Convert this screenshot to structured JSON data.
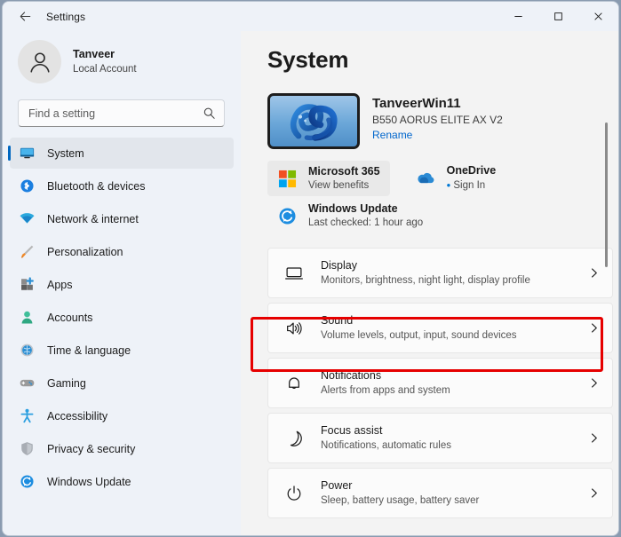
{
  "titlebar": {
    "back_icon": "back-arrow-icon",
    "title": "Settings",
    "minimize_label": "─",
    "maximize_label": "□",
    "close_label": "✕"
  },
  "sidebar": {
    "account": {
      "name": "Tanveer",
      "subtitle": "Local Account",
      "avatar_icon": "person-avatar-icon"
    },
    "search": {
      "placeholder": "Find a setting",
      "value": "",
      "icon": "search-icon"
    },
    "items": [
      {
        "label": "System",
        "icon": "monitor-icon",
        "selected": true
      },
      {
        "label": "Bluetooth & devices",
        "icon": "bluetooth-icon",
        "selected": false
      },
      {
        "label": "Network & internet",
        "icon": "wifi-icon",
        "selected": false
      },
      {
        "label": "Personalization",
        "icon": "paintbrush-icon",
        "selected": false
      },
      {
        "label": "Apps",
        "icon": "apps-icon",
        "selected": false
      },
      {
        "label": "Accounts",
        "icon": "accounts-icon",
        "selected": false
      },
      {
        "label": "Time & language",
        "icon": "clock-globe-icon",
        "selected": false
      },
      {
        "label": "Gaming",
        "icon": "gamepad-icon",
        "selected": false
      },
      {
        "label": "Accessibility",
        "icon": "accessibility-person-icon",
        "selected": false
      },
      {
        "label": "Privacy & security",
        "icon": "shield-icon",
        "selected": false
      },
      {
        "label": "Windows Update",
        "icon": "update-refresh-icon",
        "selected": false
      }
    ]
  },
  "main": {
    "page_title": "System",
    "device": {
      "name": "TanveerWin11",
      "model": "B550 AORUS ELITE AX V2",
      "rename_label": "Rename",
      "thumbnail_icon": "windows11-bloom-wallpaper-thumbnail"
    },
    "tiles": [
      {
        "title": "Microsoft 365",
        "subtitle": "View benefits",
        "icon": "microsoft-logo-icon",
        "hovered": true,
        "bullet": false
      },
      {
        "title": "OneDrive",
        "subtitle": "Sign In",
        "icon": "onedrive-cloud-icon",
        "hovered": false,
        "bullet": true
      },
      {
        "title": "Windows Update",
        "subtitle": "Last checked: 1 hour ago",
        "icon": "update-refresh-icon",
        "hovered": false,
        "bullet": false
      }
    ],
    "rows": [
      {
        "title": "Display",
        "subtitle": "Monitors, brightness, night light, display profile",
        "icon": "monitor-icon",
        "chevron": "›",
        "highlighted": false
      },
      {
        "title": "Sound",
        "subtitle": "Volume levels, output, input, sound devices",
        "icon": "speaker-icon",
        "chevron": "›",
        "highlighted": true
      },
      {
        "title": "Notifications",
        "subtitle": "Alerts from apps and system",
        "icon": "bell-icon",
        "chevron": "›",
        "highlighted": false
      },
      {
        "title": "Focus assist",
        "subtitle": "Notifications, automatic rules",
        "icon": "moon-icon",
        "chevron": "›",
        "highlighted": false
      },
      {
        "title": "Power",
        "subtitle": "Sleep, battery usage, battery saver",
        "icon": "power-icon",
        "chevron": "›",
        "highlighted": false
      }
    ],
    "annotation": {
      "type": "red-highlight-rectangle",
      "target": "Sound",
      "color": "#e60000"
    }
  },
  "colors": {
    "accent": "#0067c0",
    "link": "#0066cc",
    "annotation": "#e60000",
    "sidebar_bg": "#eef2f8",
    "content_bg": "#f3f3f3"
  }
}
